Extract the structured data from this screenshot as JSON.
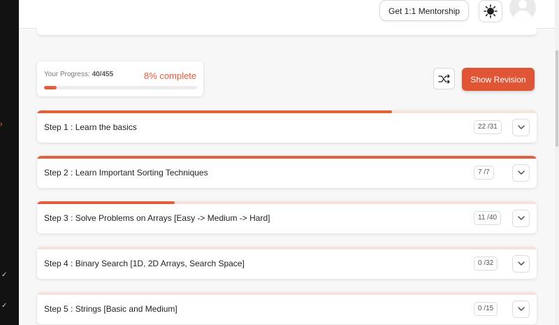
{
  "header": {
    "mentorship_label": "Get 1:1 Mentorship",
    "theme_icon": "sun-icon",
    "avatar_icon": "user-avatar-icon"
  },
  "progress": {
    "label": "Your Progress:",
    "done_total": "40/455",
    "percent_text": "8% complete",
    "fraction": 0.08
  },
  "actions": {
    "shuffle_icon": "shuffle-icon",
    "revision_label": "Show Revision"
  },
  "steps": [
    {
      "title": "Step 1 : Learn the basics",
      "count": "22 /31",
      "progress": 0.71
    },
    {
      "title": "Step 2 : Learn Important Sorting Techniques",
      "count": "7 /7",
      "progress": 1.0
    },
    {
      "title": "Step 3 : Solve Problems on Arrays [Easy -> Medium -> Hard]",
      "count": "11 /40",
      "progress": 0.275
    },
    {
      "title": "Step 4 : Binary Search [1D, 2D Arrays, Search Space]",
      "count": "0 /32",
      "progress": 0
    },
    {
      "title": "Step 5 : Strings [Basic and Medium]",
      "count": "0 /15",
      "progress": 0
    }
  ],
  "colors": {
    "accent": "#df5536",
    "page_bg": "#f7f7f7",
    "rail_bg": "#121212"
  }
}
